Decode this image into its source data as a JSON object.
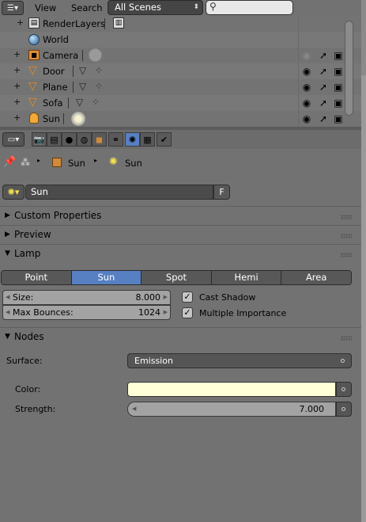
{
  "outliner": {
    "menus": [
      "View",
      "Search"
    ],
    "scene_selector": "All Scenes",
    "rows": [
      {
        "label": "RenderLayers",
        "icon": "render-layers-icon"
      },
      {
        "label": "World",
        "icon": "world-icon"
      },
      {
        "label": "Camera",
        "icon": "camera-icon"
      },
      {
        "label": "Door",
        "icon": "mesh-icon"
      },
      {
        "label": "Plane",
        "icon": "mesh-icon"
      },
      {
        "label": "Sofa",
        "icon": "mesh-icon"
      },
      {
        "label": "Sun",
        "icon": "lamp-icon"
      }
    ]
  },
  "properties": {
    "breadcrumb": [
      "Sun",
      "Sun"
    ],
    "lamp_name": "Sun",
    "fake_user": "F",
    "panels": {
      "custom_properties": "Custom Properties",
      "preview": "Preview",
      "lamp": "Lamp",
      "nodes": "Nodes"
    },
    "lamp_types": [
      "Point",
      "Sun",
      "Spot",
      "Hemi",
      "Area"
    ],
    "active_lamp_type": "Sun",
    "size_label": "Size:",
    "size_value": "8.000",
    "max_bounces_label": "Max Bounces:",
    "max_bounces_value": "1024",
    "cast_shadow": "Cast Shadow",
    "multiple_importance": "Multiple Importance",
    "surface_label": "Surface:",
    "surface_value": "Emission",
    "color_label": "Color:",
    "color_value": "#ffffd8",
    "strength_label": "Strength:",
    "strength_value": "7.000"
  },
  "colors": {
    "active_blue": "#5680c2",
    "panel_bg": "#727272",
    "field_dark": "#4b4b4b"
  }
}
